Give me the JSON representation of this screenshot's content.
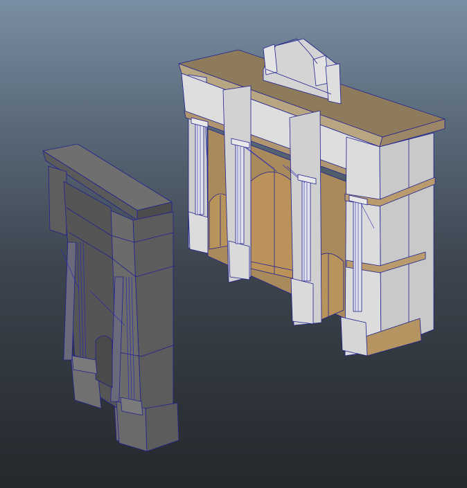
{
  "viewport": {
    "background_top": "#7b8fa4",
    "background_bottom": "#232629",
    "wireframe_color": "#1a1a8c"
  },
  "objects": [
    {
      "name": "small-arch-model",
      "material": "grey-shaded",
      "color": "#6e6e6e"
    },
    {
      "name": "large-arch-model",
      "material": "stone-and-wood",
      "colors": {
        "stone": "#d6d6d6",
        "trim": "#a08a66",
        "wood": "#b08a52"
      }
    }
  ]
}
